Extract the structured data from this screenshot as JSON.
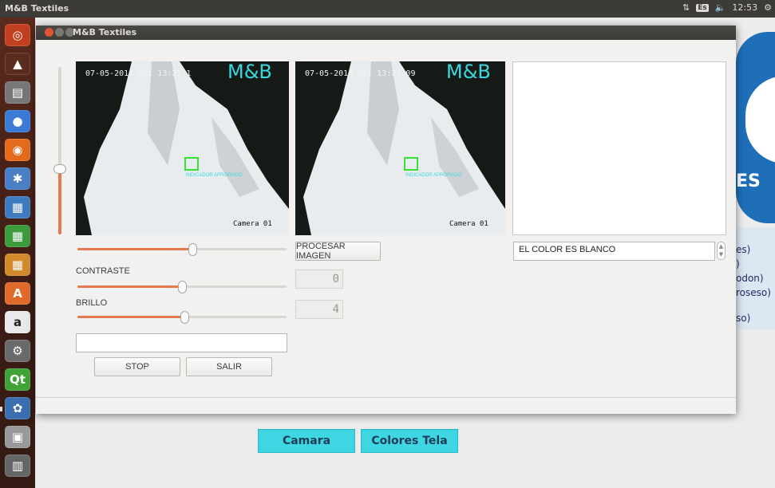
{
  "top_panel": {
    "title": "M&B Textiles",
    "keyboard": "Es",
    "time": "12:53"
  },
  "window": {
    "title": "M&B Textiles"
  },
  "cameras": [
    {
      "timestamp": "07-05-2014 Sat 13:27:1",
      "brand": "M&B",
      "camera_label": "Camera 01",
      "overlay_text": "INDICADOR APROPIADO"
    },
    {
      "timestamp": "07-05-2014 Sat 13:27:09",
      "brand": "M&B",
      "camera_label": "Camera 01",
      "overlay_text": "INDICADOR APROPIADO"
    }
  ],
  "controls": {
    "vertical_slider_value": 0.6,
    "slider1_value": 0.55,
    "contrast_label": "CONTRASTE",
    "contrast_value": 0.5,
    "brightness_label": "BRILLO",
    "brightness_value": 0.51,
    "text_input_value": "",
    "stop_label": "STOP",
    "exit_label": "SALIR",
    "process_label": "PROCESAR IMAGEN",
    "lcd1": "0",
    "lcd2": "4",
    "result_text": "EL COLOR ES BLANCO"
  },
  "background_app": {
    "camera_button": "Camara",
    "colors_button": "Colores Tela",
    "logo_text": "ES",
    "list_lines": [
      "es)",
      ")",
      "odon)",
      "roseso)",
      "",
      "so)"
    ]
  },
  "colors": {
    "accent": "#e6794e",
    "cyan_button": "#3fd6e3",
    "panel": "#3c3b37"
  }
}
